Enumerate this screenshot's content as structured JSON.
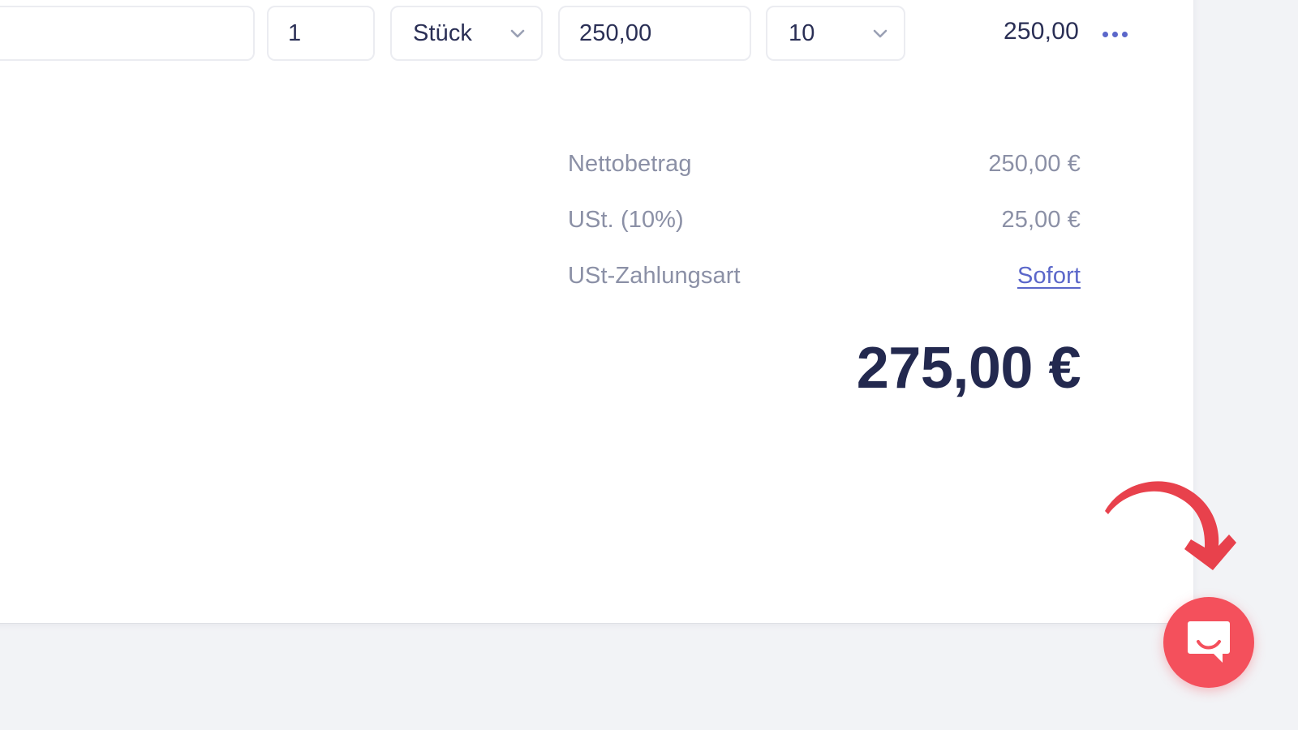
{
  "line_item": {
    "description_value": "",
    "description_placeholder": "",
    "quantity_value": "1",
    "unit_value": "Stück",
    "price_value": "250,00",
    "tax_rate_value": "10",
    "row_total": "250,00",
    "menu_icon": "ellipsis-horizontal-icon",
    "chevron_icon": "chevron-down-icon"
  },
  "totals": {
    "rows": [
      {
        "label": "Nettobetrag",
        "value": "250,00 €",
        "is_link": false
      },
      {
        "label": "USt. (10%)",
        "value": "25,00 €",
        "is_link": false
      },
      {
        "label": "USt-Zahlungsart",
        "value": "Sofort",
        "is_link": true
      }
    ],
    "grand_total": "275,00 €"
  },
  "chat_widget": {
    "icon": "intercom-chat-bubble-icon",
    "color": "#F4505C"
  },
  "annotation": {
    "icon": "curved-arrow-icon",
    "color": "#E8414C"
  },
  "colors": {
    "accent_blue": "#5B67CA",
    "text_dark": "#2A2F55",
    "text_muted": "#8B90A6",
    "page_background": "#F2F3F6",
    "card_background": "#FFFFFF",
    "field_border": "#EBECF1"
  }
}
